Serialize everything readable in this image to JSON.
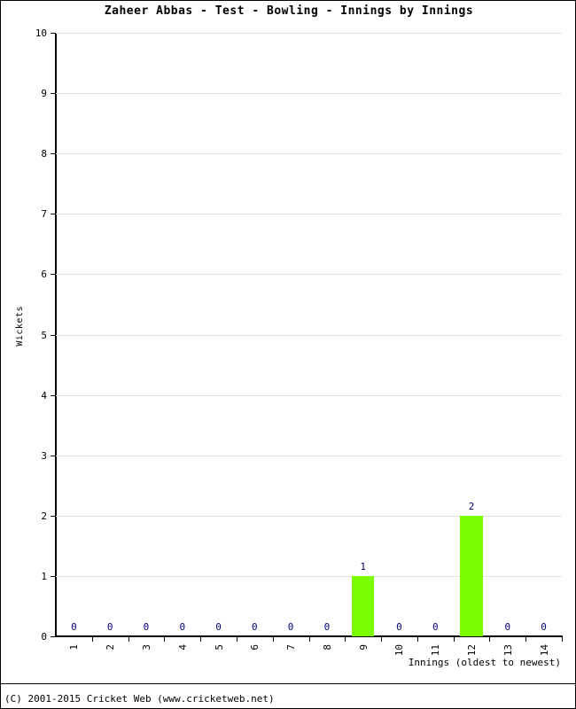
{
  "chart_data": {
    "type": "bar",
    "title": "Zaheer Abbas - Test - Bowling - Innings by Innings",
    "xlabel": "Innings (oldest to newest)",
    "ylabel": "Wickets",
    "categories": [
      "1",
      "2",
      "3",
      "4",
      "5",
      "6",
      "7",
      "8",
      "9",
      "10",
      "11",
      "12",
      "13",
      "14"
    ],
    "values": [
      0,
      0,
      0,
      0,
      0,
      0,
      0,
      0,
      1,
      0,
      0,
      2,
      0,
      0
    ],
    "data_labels": [
      "0",
      "0",
      "0",
      "0",
      "0",
      "0",
      "0",
      "0",
      "1",
      "0",
      "0",
      "2",
      "0",
      "0"
    ],
    "ylim": [
      0,
      10
    ],
    "ytick_labels": [
      "0",
      "1",
      "2",
      "3",
      "4",
      "5",
      "6",
      "7",
      "8",
      "9",
      "10"
    ],
    "ytick_values": [
      0,
      1,
      2,
      3,
      4,
      5,
      6,
      7,
      8,
      9,
      10
    ],
    "grid": true,
    "legend": "none",
    "bar_color": "#7cfc00",
    "label_color": "#000080",
    "grid_color": "#e3e3e3",
    "axis_color": "#000000",
    "background_color": "#ffffff"
  },
  "footer": {
    "credit": "(C) 2001-2015 Cricket Web (www.cricketweb.net)"
  }
}
